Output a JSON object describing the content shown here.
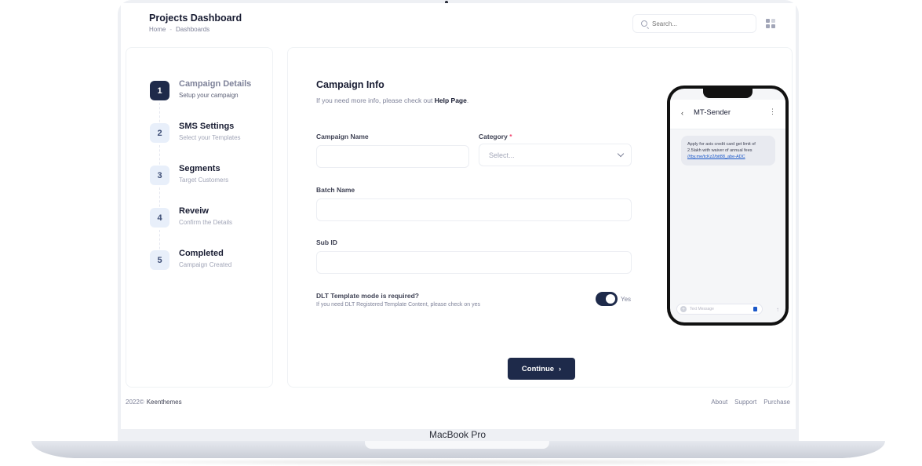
{
  "header": {
    "title": "Projects Dashboard",
    "breadcrumb": [
      "Home",
      "Dashboards"
    ],
    "search_placeholder": "Search..."
  },
  "steps": [
    {
      "number": "1",
      "title": "Campaign Details",
      "desc": "Setup your campaign",
      "active": true
    },
    {
      "number": "2",
      "title": "SMS Settings",
      "desc": "Select your Templates",
      "active": false
    },
    {
      "number": "3",
      "title": "Segments",
      "desc": "Target Customers",
      "active": false
    },
    {
      "number": "4",
      "title": "Reveiw",
      "desc": "Confirm the Details",
      "active": false
    },
    {
      "number": "5",
      "title": "Completed",
      "desc": "Campaign Created",
      "active": false
    }
  ],
  "form": {
    "heading": "Campaign Info",
    "subtitle_prefix": "If you need more info, please check out",
    "help_link": "Help Page",
    "subtitle_suffix": ".",
    "campaign_name_label": "Campaign Name",
    "campaign_name_value": "",
    "category_label": "Category",
    "category_required": "*",
    "category_placeholder": "Select...",
    "batch_name_label": "Batch Name",
    "batch_name_value": "",
    "sub_id_label": "Sub ID",
    "sub_id_value": "",
    "dlt_question": "DLT Template mode is required?",
    "dlt_hint": "If you need DLT Registered Template Content, please check on yes",
    "dlt_toggle_on": true,
    "dlt_toggle_label": "Yes",
    "continue_label": "Continue",
    "continue_arrow": "›"
  },
  "phone": {
    "sender": "MT-Sender",
    "back_glyph": "‹",
    "menu_glyph": "⋮",
    "message": "Apply for axis credit card get limit of 2.5lakh with waiver of annual fees",
    "message_link": "//tby.me/tcKz2/bit88_abe-ADC",
    "input_placeholder": "Text Message",
    "input_plus": "+",
    "send_glyph": "↑"
  },
  "footer": {
    "copyright": "2022©",
    "brand": "Keenthemes",
    "links": [
      "About",
      "Support",
      "Purchase"
    ]
  },
  "laptop": {
    "model": "MacBook Pro"
  },
  "colors": {
    "primary": "#1e2a4a",
    "step_inactive_bg": "#e8effa",
    "link_blue": "#1b58c9",
    "required": "#f1416c"
  },
  "icons": [
    "search-icon",
    "grid-menu-icon",
    "chevron-down-icon",
    "arrow-right-icon",
    "back-arrow-icon",
    "more-vertical-icon",
    "plus-icon",
    "document-icon",
    "send-icon"
  ]
}
